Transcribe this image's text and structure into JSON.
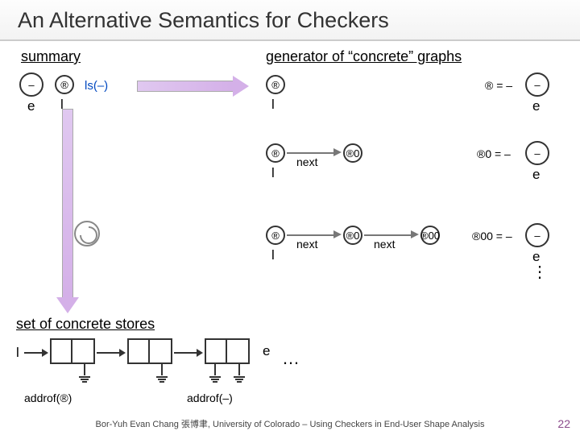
{
  "title": "An Alternative Semantics for Checkers",
  "summary_label": "summary",
  "generator_label": "generator of “concrete” graphs",
  "set_label": "set of concrete stores",
  "nodes": {
    "hyph": "–",
    "alpha": "®",
    "alphap": "®0",
    "alphapp": "®00"
  },
  "vars": {
    "e": "e",
    "l": "l"
  },
  "edge": {
    "next": "next",
    "ls": "ls(–)"
  },
  "eq": {
    "a": "® = –",
    "ap": "®0 = –",
    "app": "®00 = –"
  },
  "addrof": {
    "alpha": "addrof(®)",
    "hyph": "addrof(–)"
  },
  "dots": "…",
  "footer": "Bor-Yuh Evan Chang 張博聿, University of Colorado – Using Checkers in End-User Shape Analysis",
  "page": "22"
}
